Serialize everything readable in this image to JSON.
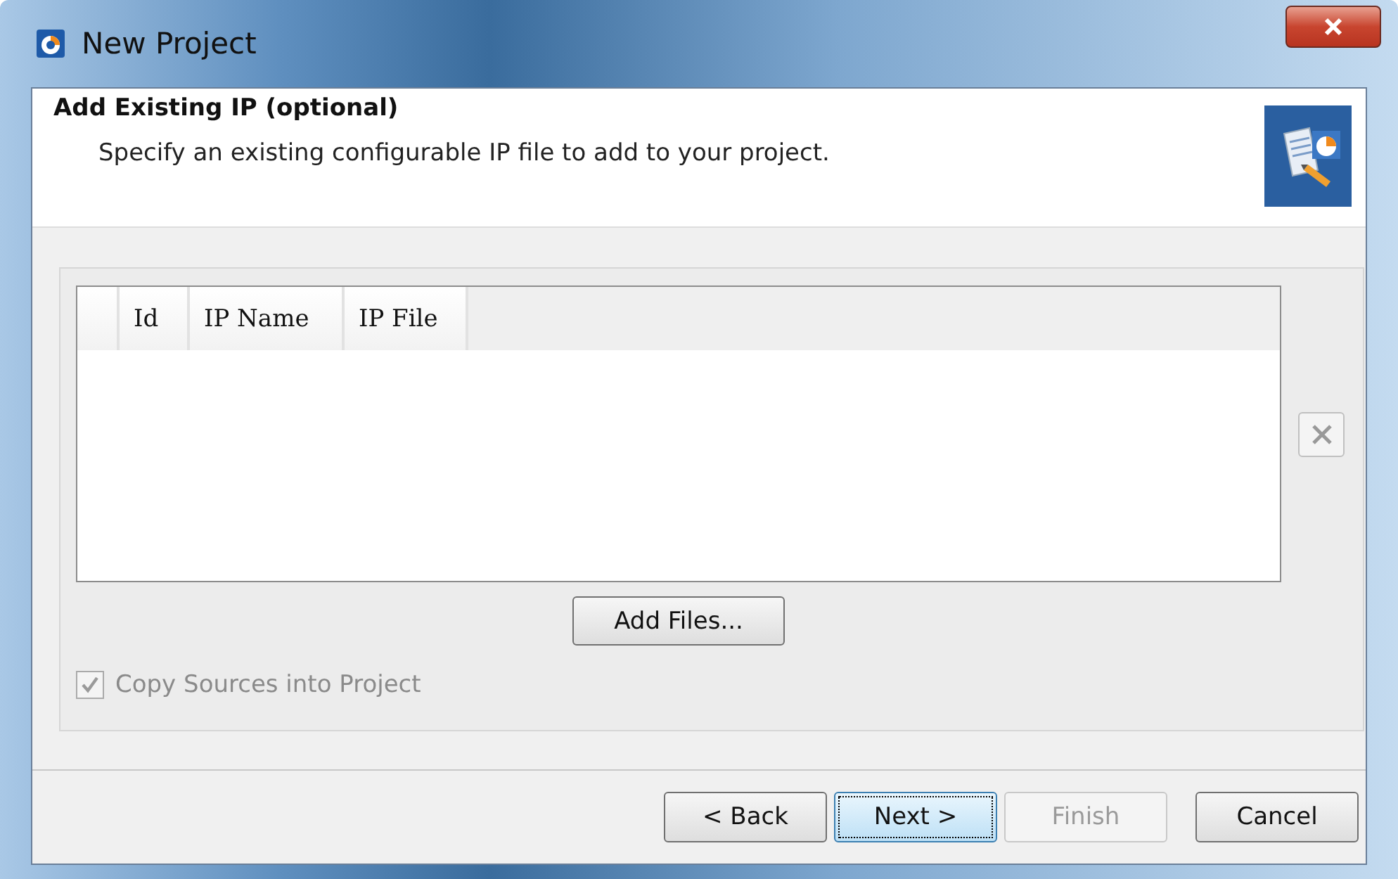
{
  "window": {
    "title": "New Project"
  },
  "header": {
    "title": "Add Existing IP (optional)",
    "description": "Specify an existing configurable IP file to add to your project."
  },
  "table": {
    "columns": [
      "Id",
      "IP Name",
      "IP File"
    ]
  },
  "add_files_button": {
    "label": "Add Files..."
  },
  "copy_sources": {
    "label": "Copy Sources into Project",
    "checked": true,
    "disabled": true
  },
  "buttons": [
    {
      "label": "< Back",
      "disabled": false,
      "focused": false
    },
    {
      "label": "Next >",
      "disabled": false,
      "focused": true
    },
    {
      "label": "Finish",
      "disabled": true,
      "focused": false
    },
    {
      "label": "Cancel",
      "disabled": false,
      "focused": false
    }
  ]
}
